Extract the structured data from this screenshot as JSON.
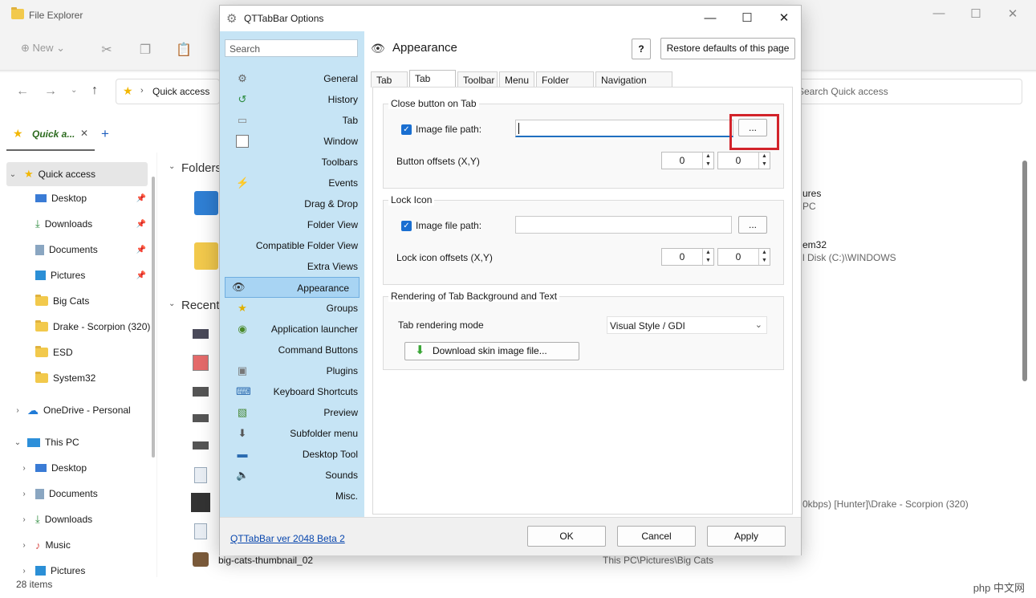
{
  "explorer": {
    "window_title": "File Explorer",
    "toolbar": {
      "new_label": "New"
    },
    "address": {
      "current": "Quick access",
      "search_placeholder": "Search Quick access"
    },
    "tab_label": "Quick a...",
    "nav": {
      "quick_access": "Quick access",
      "items": [
        "Desktop",
        "Downloads",
        "Documents",
        "Pictures",
        "Big Cats",
        "Drake - Scorpion (320)",
        "ESD",
        "System32"
      ],
      "onedrive": "OneDrive - Personal",
      "this_pc": "This PC",
      "pc_items": [
        "Desktop",
        "Documents",
        "Downloads",
        "Music",
        "Pictures"
      ]
    },
    "content": {
      "folders_header": "Folders",
      "recent_header": "Recent",
      "peek_pictures": "ures",
      "peek_pc": "PC",
      "peek_system32": "em32",
      "peek_windows": "l Disk (C:)\\WINDOWS",
      "peek_drake": "0kbps) [Hunter]\\Drake - Scorpion (320)",
      "last_file": "big-cats-thumbnail_02",
      "last_path": "This PC\\Pictures\\Big Cats"
    },
    "status": "28 items",
    "watermark": "php 中文网"
  },
  "dialog": {
    "title": "QTTabBar Options",
    "search_placeholder": "Search",
    "sidebar": [
      "General",
      "History",
      "Tab",
      "Window",
      "Toolbars",
      "Events",
      "Drag & Drop",
      "Folder View",
      "Compatible Folder View",
      "Extra Views",
      "Appearance",
      "Groups",
      "Application launcher",
      "Command Buttons",
      "Plugins",
      "Keyboard Shortcuts",
      "Preview",
      "Subfolder menu",
      "Desktop Tool",
      "Sounds",
      "Misc."
    ],
    "selected": "Appearance",
    "page_title": "Appearance",
    "help_label": "?",
    "restore_label": "Restore defaults of this page",
    "tabs": [
      "Tab",
      "Tab skins",
      "Toolbar",
      "Menu",
      "Folder View",
      "Navigation pane"
    ],
    "active_tab": "Tab skins",
    "close_group": {
      "title": "Close button on Tab",
      "image_label": "Image file path:",
      "browse": "...",
      "offsets_label": "Button offsets (X,Y)",
      "x": "0",
      "y": "0"
    },
    "lock_group": {
      "title": "Lock Icon",
      "image_label": "Image file path:",
      "browse": "...",
      "offsets_label": "Lock icon offsets (X,Y)",
      "x": "0",
      "y": "0"
    },
    "render_group": {
      "title": "Rendering of Tab Background and Text",
      "mode_label": "Tab rendering mode",
      "mode_value": "Visual Style / GDI",
      "download_label": "Download skin image file..."
    },
    "version_link": "QTTabBar ver 2048 Beta 2",
    "ok": "OK",
    "cancel": "Cancel",
    "apply": "Apply"
  }
}
